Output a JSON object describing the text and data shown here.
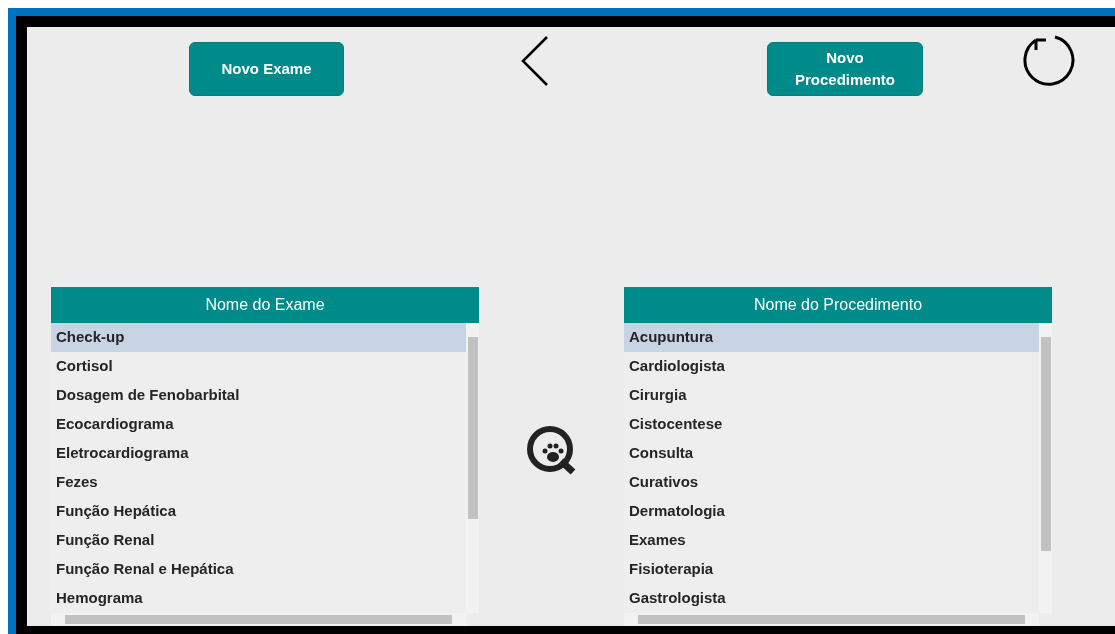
{
  "top_buttons": [
    {
      "label": "Novo Exame"
    },
    {
      "label": "Novo\nProcedimento"
    }
  ],
  "lists": [
    {
      "header": "Nome do Exame",
      "items": [
        {
          "label": "Check-up",
          "selected": true
        },
        {
          "label": "Cortisol",
          "selected": false
        },
        {
          "label": "Dosagem de Fenobarbital",
          "selected": false
        },
        {
          "label": "Ecocardiograma",
          "selected": false
        },
        {
          "label": "Eletrocardiograma",
          "selected": false
        },
        {
          "label": "Fezes",
          "selected": false
        },
        {
          "label": "Função Hepática",
          "selected": false
        },
        {
          "label": "Função Renal",
          "selected": false
        },
        {
          "label": "Função Renal e Hepática",
          "selected": false
        },
        {
          "label": "Hemograma",
          "selected": false
        }
      ]
    },
    {
      "header": "Nome do Procedimento",
      "items": [
        {
          "label": "Acupuntura",
          "selected": true
        },
        {
          "label": "Cardiologista",
          "selected": false
        },
        {
          "label": "Cirurgia",
          "selected": false
        },
        {
          "label": "Cistocentese",
          "selected": false
        },
        {
          "label": "Consulta",
          "selected": false
        },
        {
          "label": "Curativos",
          "selected": false
        },
        {
          "label": "Dermatologia",
          "selected": false
        },
        {
          "label": "Exames",
          "selected": false
        },
        {
          "label": "Fisioterapia",
          "selected": false
        },
        {
          "label": "Gastrologista",
          "selected": false
        }
      ]
    }
  ]
}
